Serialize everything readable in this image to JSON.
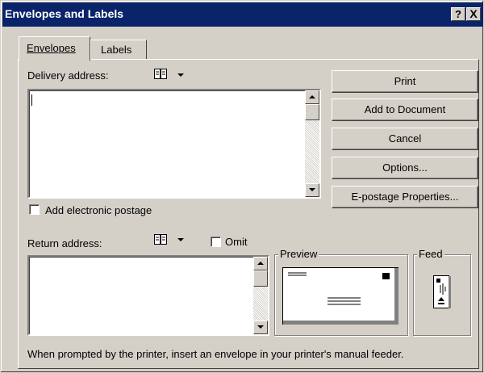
{
  "window": {
    "title": "Envelopes and Labels",
    "help_glyph": "?",
    "close_glyph": "X"
  },
  "tabs": [
    {
      "label": "Envelopes",
      "active": true
    },
    {
      "label": "Labels",
      "active": false
    }
  ],
  "delivery": {
    "label": "Delivery address:",
    "value": ""
  },
  "postage": {
    "label": "Add electronic postage",
    "checked": false
  },
  "return": {
    "label": "Return address:",
    "value": ""
  },
  "omit": {
    "label": "Omit",
    "checked": false
  },
  "buttons": {
    "print": "Print",
    "add_to_document": "Add to Document",
    "cancel": "Cancel",
    "options": "Options...",
    "epostage": "E-postage Properties..."
  },
  "preview": {
    "label": "Preview"
  },
  "feed": {
    "label": "Feed"
  },
  "footer": "When prompted by the printer, insert an envelope in your printer's manual feeder.",
  "icons": [
    "address-book-icon",
    "dropdown-arrow-icon",
    "scroll-up-icon",
    "scroll-down-icon",
    "envelope-preview-icon",
    "envelope-feed-icon"
  ]
}
